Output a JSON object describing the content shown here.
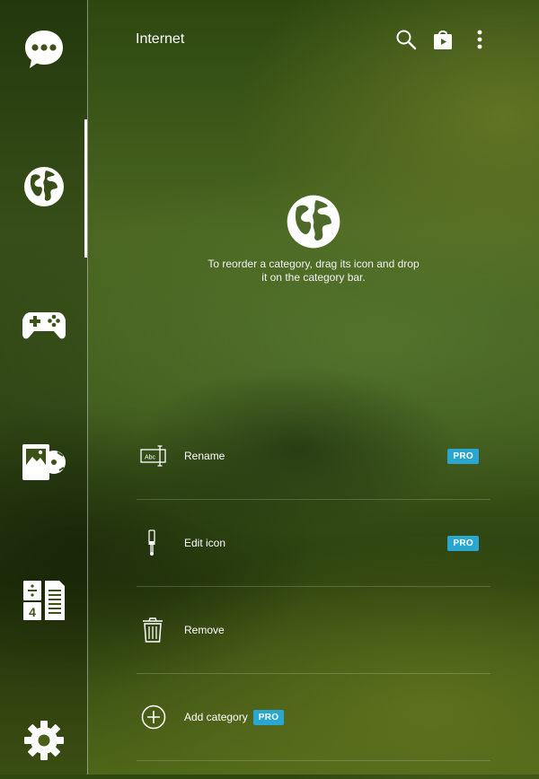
{
  "header": {
    "title": "Internet",
    "icons": [
      "search-icon",
      "store-icon",
      "overflow-menu-icon"
    ]
  },
  "sidebar": {
    "items": [
      {
        "name": "chat",
        "icon": "chat-bubble-icon"
      },
      {
        "name": "internet",
        "icon": "globe-icon",
        "active": true
      },
      {
        "name": "games",
        "icon": "gamepad-icon"
      },
      {
        "name": "media",
        "icon": "media-icon"
      },
      {
        "name": "tools",
        "icon": "calculator-icon"
      },
      {
        "name": "settings",
        "icon": "gear-icon"
      }
    ]
  },
  "empty_state": {
    "icon": "globe-icon",
    "hint": "To reorder a category, drag its icon and drop it on the category bar."
  },
  "menu": {
    "items": [
      {
        "label": "Rename",
        "icon": "rename-icon",
        "badge": "PRO"
      },
      {
        "label": "Edit icon",
        "icon": "paintbrush-icon",
        "badge": "PRO"
      },
      {
        "label": "Remove",
        "icon": "trash-icon"
      },
      {
        "label": "Add category",
        "icon": "add-circle-icon",
        "badge": "PRO"
      }
    ]
  },
  "colors": {
    "badge": "#29a7d1",
    "accent_indicator": "#ffffff"
  }
}
